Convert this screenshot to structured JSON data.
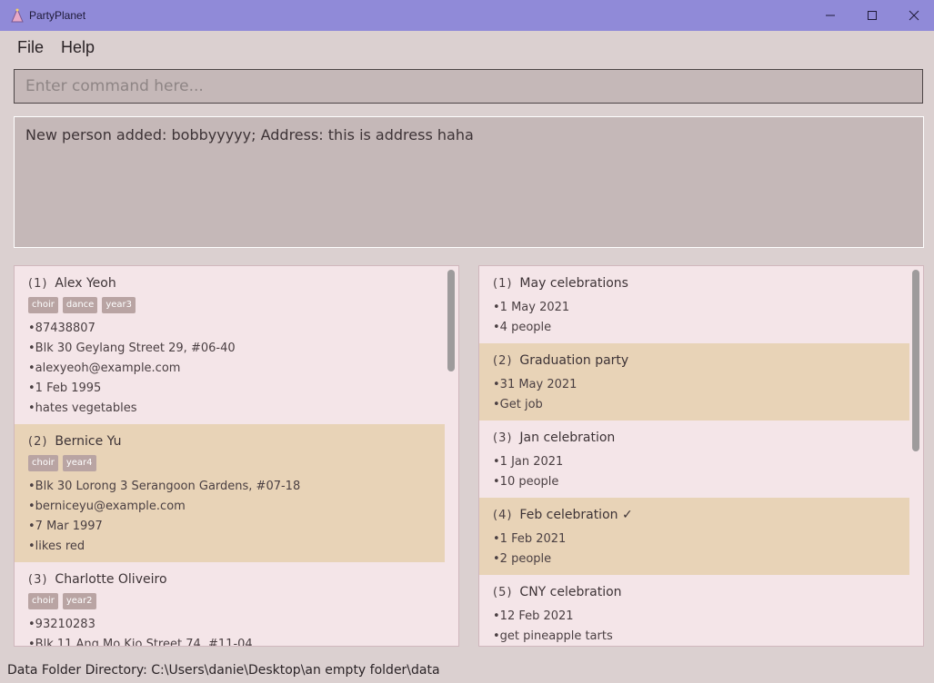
{
  "window": {
    "title": "PartyPlanet"
  },
  "menu": {
    "file": "File",
    "help": "Help"
  },
  "command": {
    "placeholder": "Enter command here...",
    "value": ""
  },
  "result": {
    "text": "New person added: bobbyyyyy; Address: this is address haha"
  },
  "persons": [
    {
      "index": "(1)",
      "name": "Alex Yeoh",
      "tags": [
        "choir",
        "dance",
        "year3"
      ],
      "fields": [
        "•87438807",
        "•Blk 30 Geylang Street 29, #06-40",
        "•alexyeoh@example.com",
        "•1 Feb 1995",
        "•hates vegetables"
      ]
    },
    {
      "index": "(2)",
      "name": "Bernice Yu",
      "tags": [
        "choir",
        "year4"
      ],
      "fields": [
        "•Blk 30 Lorong 3 Serangoon Gardens, #07-18",
        "•berniceyu@example.com",
        "•7 Mar 1997",
        "•likes red"
      ]
    },
    {
      "index": "(3)",
      "name": "Charlotte Oliveiro",
      "tags": [
        "choir",
        "year2"
      ],
      "fields": [
        "•93210283",
        "•Blk 11 Ang Mo Kio Street 74, #11-04"
      ]
    }
  ],
  "events": [
    {
      "index": "(1)",
      "name": "May celebrations",
      "fields": [
        "•1 May 2021",
        "•4 people"
      ]
    },
    {
      "index": "(2)",
      "name": "Graduation party",
      "fields": [
        "•31 May 2021",
        "•Get job"
      ]
    },
    {
      "index": "(3)",
      "name": "Jan celebration",
      "fields": [
        "•1 Jan 2021",
        "•10 people"
      ]
    },
    {
      "index": "(4)",
      "name": "Feb celebration ✓",
      "fields": [
        "•1 Feb 2021",
        "•2 people"
      ]
    },
    {
      "index": "(5)",
      "name": "CNY celebration",
      "fields": [
        "•12 Feb 2021",
        "•get pineapple tarts"
      ]
    }
  ],
  "status": {
    "text": "Data Folder Directory: C:\\Users\\danie\\Desktop\\an empty folder\\data"
  },
  "colors": {
    "titlebar": "#908ad8",
    "card_alt": "#e8d3b7",
    "tag": "#b9a4a3",
    "panel": "#f4e5e8"
  }
}
